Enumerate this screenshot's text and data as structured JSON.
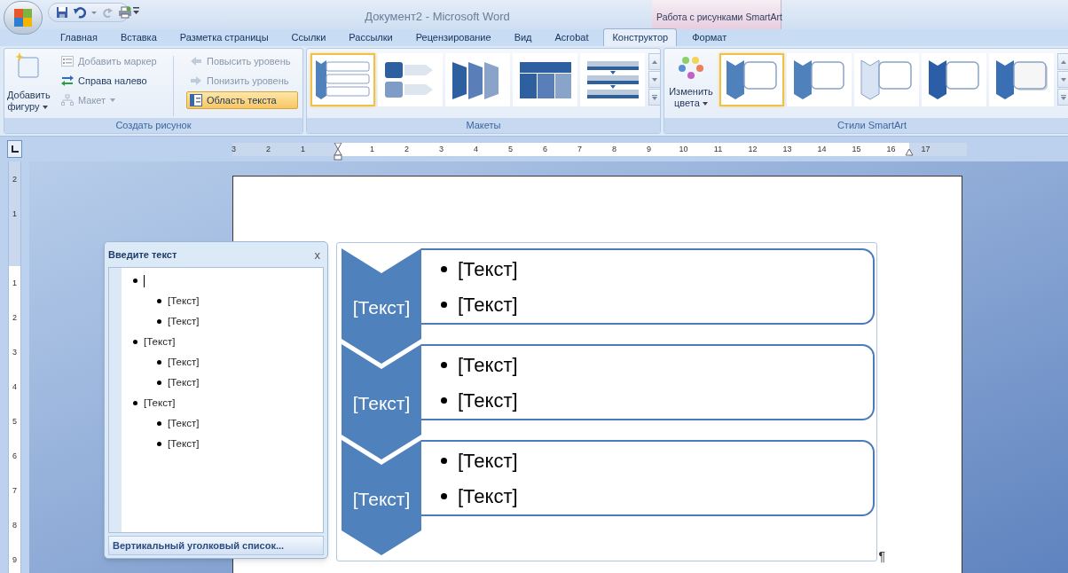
{
  "window": {
    "title": "Документ2 - Microsoft Word"
  },
  "context_group": {
    "label": "Работа с рисунками SmartArt"
  },
  "tabs": [
    {
      "label": "Главная",
      "selected": false
    },
    {
      "label": "Вставка",
      "selected": false
    },
    {
      "label": "Разметка страницы",
      "selected": false
    },
    {
      "label": "Ссылки",
      "selected": false
    },
    {
      "label": "Рассылки",
      "selected": false
    },
    {
      "label": "Рецензирование",
      "selected": false
    },
    {
      "label": "Вид",
      "selected": false
    },
    {
      "label": "Acrobat",
      "selected": false
    },
    {
      "label": "Конструктор",
      "selected": true
    },
    {
      "label": "Формат",
      "selected": false
    }
  ],
  "create_group": {
    "label": "Создать рисунок",
    "add_shape": {
      "label": "Добавить фигуру"
    },
    "columns": [
      [
        {
          "kind": "bullet",
          "label": "Добавить маркер",
          "disabled": true,
          "on": false,
          "dropdown": false
        },
        {
          "kind": "rtl",
          "label": "Справа налево",
          "disabled": false,
          "on": false,
          "dropdown": false
        },
        {
          "kind": "layout",
          "label": "Макет",
          "disabled": true,
          "on": false,
          "dropdown": true
        }
      ],
      [
        {
          "kind": "promote",
          "label": "Повысить уровень",
          "disabled": true,
          "on": false,
          "dropdown": false
        },
        {
          "kind": "demote",
          "label": "Понизить уровень",
          "disabled": true,
          "on": false,
          "dropdown": false
        },
        {
          "kind": "text-pane",
          "label": "Область текста",
          "disabled": false,
          "on": true,
          "dropdown": false
        }
      ]
    ]
  },
  "layouts_group": {
    "label": "Макеты",
    "items": [
      {
        "kind": "chevron-list",
        "selected": true
      },
      {
        "kind": "arrow-process",
        "selected": false
      },
      {
        "kind": "trapezoid",
        "selected": false
      },
      {
        "kind": "table",
        "selected": false
      },
      {
        "kind": "stacked",
        "selected": false
      }
    ]
  },
  "styles_group": {
    "label": "Стили SmartArt",
    "change_colors": {
      "label": "Изменить цвета"
    },
    "items": [
      {
        "kind": "flat",
        "selected": true
      },
      {
        "kind": "flat",
        "selected": false
      },
      {
        "kind": "outline",
        "selected": false
      },
      {
        "kind": "intense",
        "selected": false
      },
      {
        "kind": "shadow",
        "selected": false
      }
    ]
  },
  "horizontal_ruler": {
    "labels_before": [
      "3",
      "2",
      "1"
    ],
    "labels_after": [
      "1",
      "2",
      "3",
      "4",
      "5",
      "6",
      "7",
      "8",
      "9",
      "10",
      "11",
      "12",
      "13",
      "14",
      "15",
      "16",
      "17"
    ]
  },
  "vertical_ruler": {
    "labels_before": [
      "2",
      "1"
    ],
    "labels_after": [
      "1",
      "2",
      "3",
      "4",
      "5",
      "6",
      "7",
      "8",
      "9"
    ]
  },
  "text_pane": {
    "title": "Введите текст",
    "close": "x",
    "items": [
      {
        "cursor": true,
        "children": [
          {
            "text": "[Текст]",
            "cursor": false
          },
          {
            "text": "[Текст]",
            "cursor": false
          }
        ]
      },
      {
        "text": "[Текст]",
        "cursor": false,
        "children": [
          {
            "text": "[Текст]",
            "cursor": false
          },
          {
            "text": "[Текст]",
            "cursor": false
          }
        ]
      },
      {
        "text": "[Текст]",
        "cursor": false,
        "children": [
          {
            "text": "[Текст]",
            "cursor": false
          },
          {
            "text": "[Текст]",
            "cursor": false
          }
        ]
      }
    ],
    "footer": "Вертикальный уголковый список..."
  },
  "smartart": {
    "rows": [
      {
        "label": "[Текст]",
        "bullets": [
          "[Текст]",
          "[Текст]"
        ]
      },
      {
        "label": "[Текст]",
        "bullets": [
          "[Текст]",
          "[Текст]"
        ]
      },
      {
        "label": "[Текст]",
        "bullets": [
          "[Текст]",
          "[Текст]"
        ]
      }
    ],
    "paragraph_mark": "¶"
  }
}
